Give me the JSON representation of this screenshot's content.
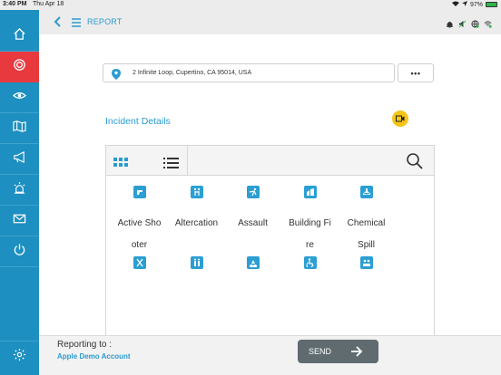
{
  "status_bar": {
    "time": "3:40 PM",
    "date": "Thu Apr 18",
    "battery": "97%",
    "battery_level": 0.97
  },
  "header": {
    "title": "REPORT"
  },
  "sidebar": {
    "items": [
      {
        "name": "home",
        "icon": "home-icon"
      },
      {
        "name": "report",
        "icon": "target-icon",
        "active": true
      },
      {
        "name": "watch",
        "icon": "eye-icon"
      },
      {
        "name": "map",
        "icon": "map-icon"
      },
      {
        "name": "announce",
        "icon": "megaphone-icon"
      },
      {
        "name": "alarm",
        "icon": "alarm-icon"
      },
      {
        "name": "messages",
        "icon": "mail-icon"
      },
      {
        "name": "power",
        "icon": "power-icon"
      },
      {
        "name": "settings",
        "icon": "gear-icon"
      }
    ]
  },
  "location": {
    "address": "2 Infinite Loop, Cupertino, CA 95014, USA",
    "more_label": "•••"
  },
  "incident": {
    "title": "Incident Details",
    "types": [
      {
        "label": "Active Shooter",
        "line1": "Active Sho",
        "line2": "oter"
      },
      {
        "label": "Altercation",
        "line1": "Altercation",
        "line2": ""
      },
      {
        "label": "Assault",
        "line1": "Assault",
        "line2": ""
      },
      {
        "label": "Building Fire",
        "line1": "Building Fi",
        "line2": "re"
      },
      {
        "label": "Chemical Spill",
        "line1": "Chemical",
        "line2": "Spill"
      }
    ]
  },
  "footer": {
    "reporting_label": "Reporting to :",
    "account": "Apple Demo Account",
    "send_label": "SEND"
  },
  "colors": {
    "accent": "#2a9bd0",
    "sidebar": "#1d8fc0",
    "active": "#e8393f",
    "camera": "#f5c518",
    "send": "#5f6b6f"
  }
}
